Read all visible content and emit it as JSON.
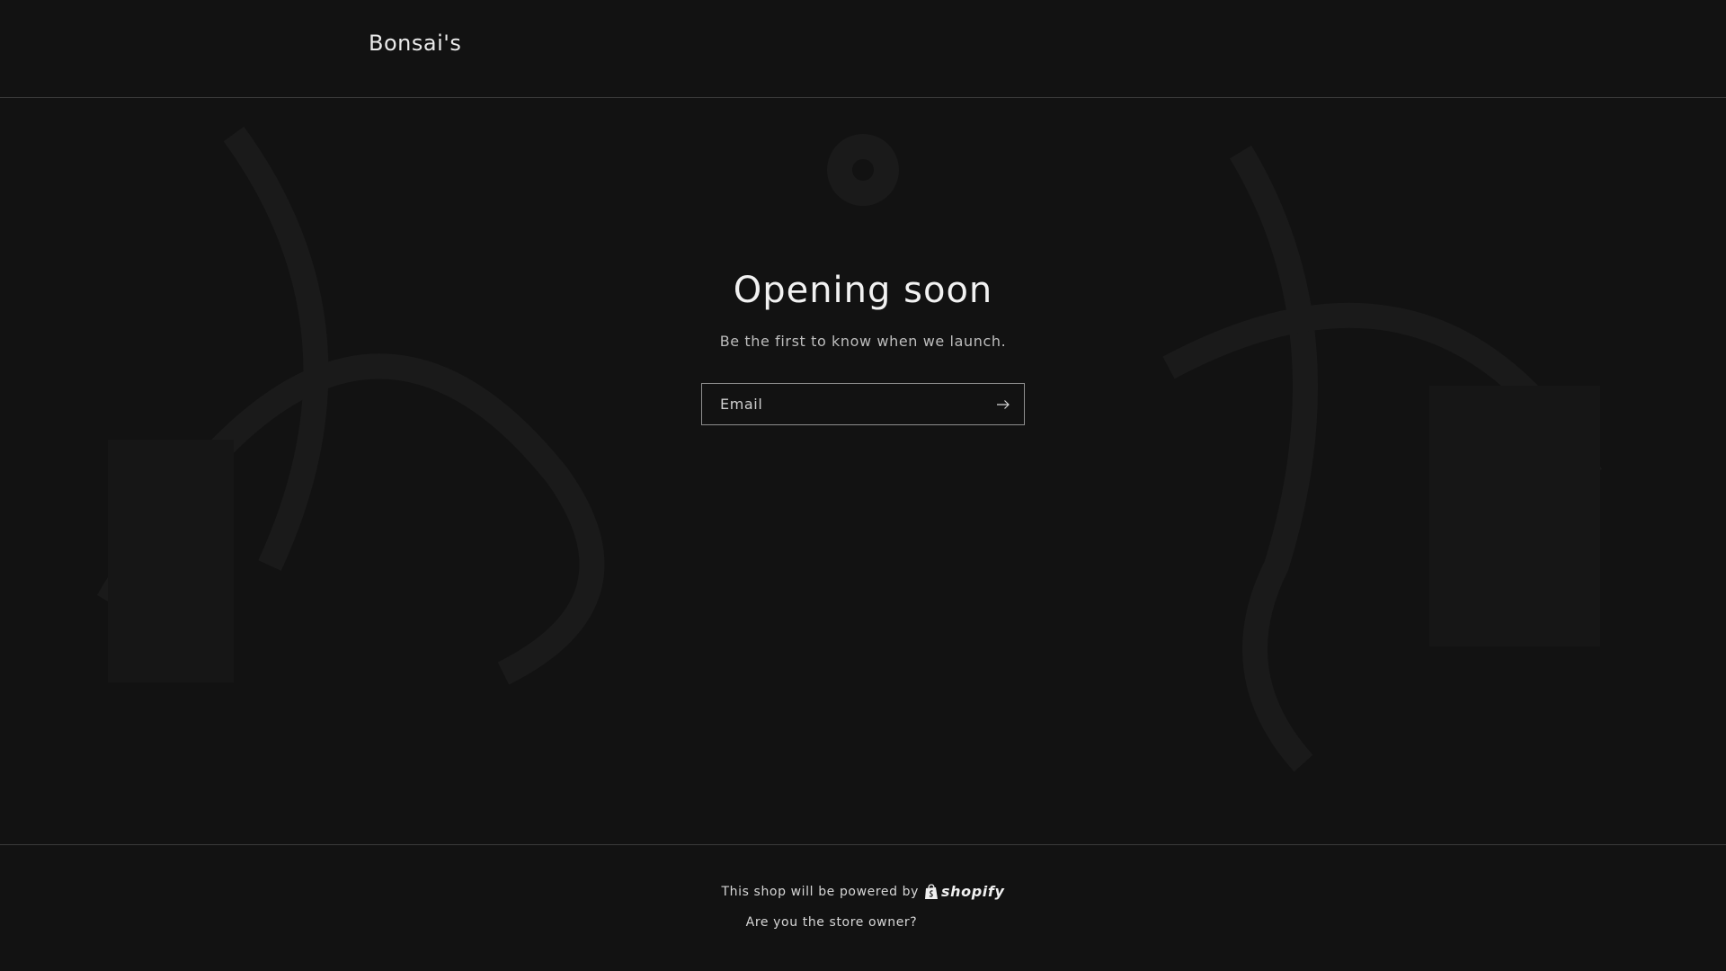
{
  "header": {
    "brand": "Bonsai's"
  },
  "hero": {
    "title": "Opening soon",
    "subtitle": "Be the first to know when we launch."
  },
  "signup": {
    "email_placeholder": "Email",
    "submit_icon": "arrow-right-icon"
  },
  "footer": {
    "powered_text": "This shop will be powered by",
    "shopify_label": "shopify",
    "shopify_icon": "shopify-bag-icon",
    "owner_link": "Are you the store owner?"
  },
  "colors": {
    "background": "#121212",
    "text": "#e6e6e6",
    "border": "#3a3a3a"
  }
}
